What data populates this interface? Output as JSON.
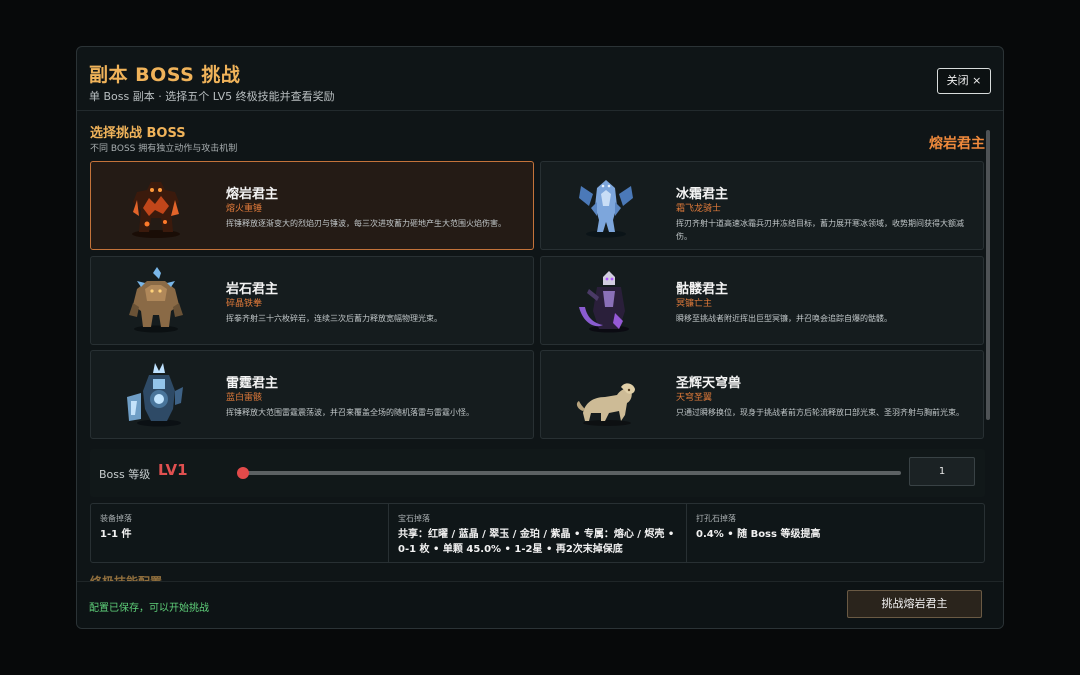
{
  "header": {
    "title": "副本 BOSS 挑战",
    "subtitle": "单 Boss 副本 · 选择五个 LV5 终极技能并查看奖励",
    "close_label": "关闭 ×"
  },
  "selection": {
    "title": "选择挑战 BOSS",
    "subtitle": "不同 BOSS 拥有独立动作与攻击机制",
    "selected_name": "熔岩君主"
  },
  "bosses": [
    {
      "name": "熔岩君主",
      "tag": "熔火重锤",
      "desc": "挥锤释放逐渐变大的烈焰刃与锤波，每三次进攻蓄力砸地产生大范围火焰伤害。",
      "active": true,
      "icon": "lava-golem-icon"
    },
    {
      "name": "冰霜君主",
      "tag": "霜飞龙骑士",
      "desc": "挥刃齐射十道高速冰霜兵刃并冻结目标，蓄力展开寒冰领域，收势期间获得大额减伤。",
      "active": false,
      "icon": "frost-knight-icon"
    },
    {
      "name": "岩石君主",
      "tag": "碎晶铁拳",
      "desc": "挥拳齐射三十六枚碎岩，连续三次后蓄力释放宽幅物理光束。",
      "active": false,
      "icon": "rock-golem-icon"
    },
    {
      "name": "骷髅君主",
      "tag": "冥镰亡主",
      "desc": "瞬移至挑战者附近挥出巨型冥镰，并召唤会追踪自爆的骷髅。",
      "active": false,
      "icon": "skeleton-lord-icon"
    },
    {
      "name": "雷霆君主",
      "tag": "蓝白雷骸",
      "desc": "挥锤释放大范围雷霆震荡波，并召来覆盖全场的随机落雷与雷霆小怪。",
      "active": false,
      "icon": "thunder-lord-icon"
    },
    {
      "name": "圣辉天穹兽",
      "tag": "天穹圣翼",
      "desc": "只通过瞬移换位，现身于挑战者前方后轮流释放口部光束、圣羽齐射与胸前光束。",
      "active": false,
      "icon": "celestial-beast-icon"
    }
  ],
  "level": {
    "label": "Boss 等级",
    "value_text": "LV1",
    "input_value": "1",
    "slider_fraction": 0.0
  },
  "drops": [
    {
      "head": "装备掉落",
      "value": "1-1 件"
    },
    {
      "head": "宝石掉落",
      "value": "共享：红曜 / 蓝晶 / 翠玉 / 金珀 / 紫晶 • 专属：熔心 / 烬壳 • 0-1 枚 • 单颗 45.0% • 1-2星 • 再2次末掉保底"
    },
    {
      "head": "打孔石掉落",
      "value": "0.4% • 随 Boss 等级提高"
    }
  ],
  "next_section": "终极技能配置",
  "footer": {
    "status": "配置已保存，可以开始挑战",
    "challenge_label": "挑战熔岩君主"
  },
  "colors": {
    "accent_gold": "#f0b35a",
    "accent_orange": "#f08a3c",
    "level_red": "#e05050",
    "status_green": "#5fd07a"
  }
}
